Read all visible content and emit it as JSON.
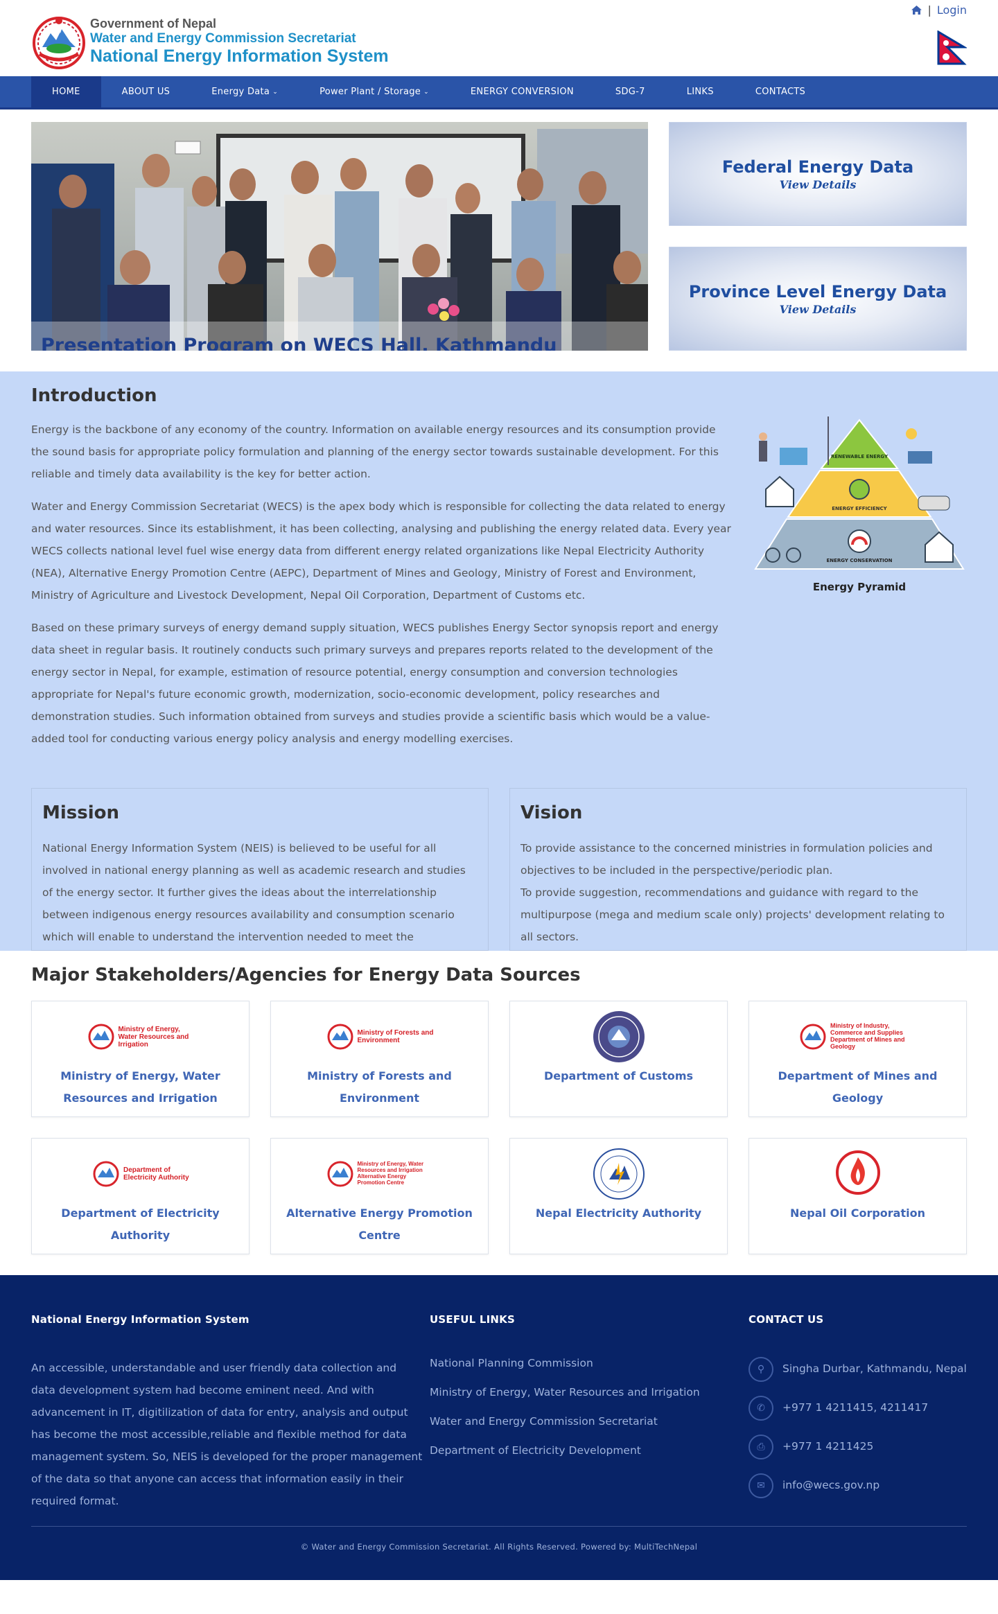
{
  "header": {
    "logo_line1": "Government of Nepal",
    "logo_line2": "Water and Energy Commission Secretariat",
    "logo_line3": "National Energy Information System",
    "login_label": "Login",
    "home_icon": "home-icon",
    "separator": "|"
  },
  "nav": {
    "items": [
      {
        "label": "HOME"
      },
      {
        "label": "ABOUT US"
      },
      {
        "label": "Energy Data"
      },
      {
        "label": "Power Plant / Storage"
      },
      {
        "label": "ENERGY CONVERSION"
      },
      {
        "label": "SDG-7"
      },
      {
        "label": "LINKS"
      },
      {
        "label": "CONTACTS"
      }
    ]
  },
  "hero": {
    "caption": "Presentation Program on WECS Hall, Kathmandu",
    "federal_title": "Federal Energy Data",
    "federal_link": "View Details",
    "province_title": "Province Level Energy Data",
    "province_link": "View Details"
  },
  "intro": {
    "title": "Introduction",
    "p1": "Energy is the backbone of any economy of the country. Information on available energy resources and its consumption provide the sound basis for appropriate policy formulation and planning of the energy sector towards sustainable development. For this reliable and timely data availability is the key for better action.",
    "p2": "Water and Energy Commission Secretariat (WECS) is the apex body which is responsible for collecting the data related to energy and water resources. Since its establishment, it has been collecting, analysing and publishing the energy related data. Every year WECS collects national level fuel wise energy data from different energy related organizations like Nepal Electricity Authority (NEA), Alternative Energy Promotion Centre (AEPC), Department of Mines and Geology, Ministry of Forest and Environment, Ministry of Agriculture and Livestock Development, Nepal Oil Corporation, Department of Customs etc.",
    "p3": "Based on these primary surveys of energy demand supply situation, WECS publishes Energy Sector synopsis report and energy data sheet in regular basis. It routinely conducts such primary surveys and prepares reports related to the development of the energy sector in Nepal, for example, estimation of resource potential, energy consumption and conversion technologies appropriate for Nepal's future economic growth, modernization, socio-economic development, policy researches and demonstration studies. Such information obtained from surveys and studies provide a scientific basis which would be a value-added tool for conducting various energy policy analysis and energy modelling exercises.",
    "pyramid_caption": "Energy Pyramid",
    "pyramid_labels": [
      "RENEWABLE ENERGY",
      "ENERGY EFFICIENCY",
      "ENERGY CONSERVATION"
    ]
  },
  "mission": {
    "title": "Mission",
    "text": "National Energy Information System (NEIS) is believed to be useful for all involved in national energy planning as well as academic research and studies of the energy sector. It further gives the ideas about the interrelationship between indigenous energy resources availability and consumption scenario which will enable to understand the intervention needed to meet the"
  },
  "vision": {
    "title": "Vision",
    "line1": "To provide assistance to the concerned ministries in formulation policies and objectives to be included in the perspective/periodic plan.",
    "line2": "To provide suggestion, recommendations and guidance with regard to the multipurpose (mega and medium scale only) projects' development relating to all sectors."
  },
  "stakeholders": {
    "title": "Major Stakeholders/Agencies for Energy Data Sources",
    "items": [
      {
        "name": "Ministry of Energy, Water Resources and Irrigation",
        "logo_text": "Ministry of Energy, Water Resources and Irrigation"
      },
      {
        "name": "Ministry of Forests and Environment",
        "logo_text": "Ministry of Forests and Environment"
      },
      {
        "name": "Department of Customs",
        "logo_text": ""
      },
      {
        "name": "Department of Mines and Geology",
        "logo_text": "Ministry of Industry, Commerce and Supplies Department of Mines and Geology"
      },
      {
        "name": "Department of Electricity Authority",
        "logo_text": "Department of Electricity Authority"
      },
      {
        "name": "Alternative Energy Promotion Centre",
        "logo_text": "Ministry of Energy, Water Resources and Irrigation Alternative Energy Promotion Centre"
      },
      {
        "name": "Nepal Electricity Authority",
        "logo_text": ""
      },
      {
        "name": "Nepal Oil Corporation",
        "logo_text": ""
      }
    ]
  },
  "footer": {
    "col1_title": "National Energy Information System",
    "about": "An accessible, understandable and user friendly data collection and data development  system had become eminent need. And with advancement in IT, digitilization of data for entry, analysis and output has become the most accessible,reliable and flexible method for data management system. So, NEIS is developed for the proper management of the data so that anyone can access that information easily in their required format.",
    "col2_title": "USEFUL LINKS",
    "links": [
      "National Planning Commission",
      "Ministry of Energy, Water Resources and Irrigation",
      "Water and Energy Commission Secretariat",
      "Department of Electricity Development"
    ],
    "col3_title": "CONTACT US",
    "address": "Singha Durbar, Kathmandu, Nepal",
    "phone": "+977 1 4211415, 4211417",
    "fax": "+977 1 4211425",
    "email": "info@wecs.gov.np",
    "copyright": "© Water and Energy Commission Secretariat. All Rights Reserved. Powered by: MultiTechNepal"
  },
  "colors": {
    "nav_bg": "#2a54a8",
    "intro_bg": "#c5d8f8",
    "footer_bg": "#082367",
    "accent": "#1f4ea0"
  }
}
